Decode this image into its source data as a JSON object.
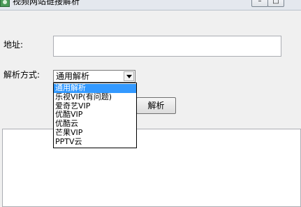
{
  "window": {
    "title": "视频网站链接解析",
    "minimize_glyph": "–",
    "maximize_glyph": "□"
  },
  "form": {
    "address_label": "地址:",
    "address_value": "",
    "method_label": "解析方式:",
    "method_selected": "通用解析",
    "parse_button": "解析"
  },
  "dropdown": {
    "options": [
      "通用解析",
      "乐视VIP(有问题)",
      "爱奇艺VIP",
      "优酷VIP",
      "优酷云",
      "芒果VIP",
      "PPTV云"
    ],
    "highlighted_index": 0
  },
  "output": {
    "value": ""
  },
  "icons": {
    "app": "app-icon",
    "dropdown": "chevron-down-icon"
  }
}
